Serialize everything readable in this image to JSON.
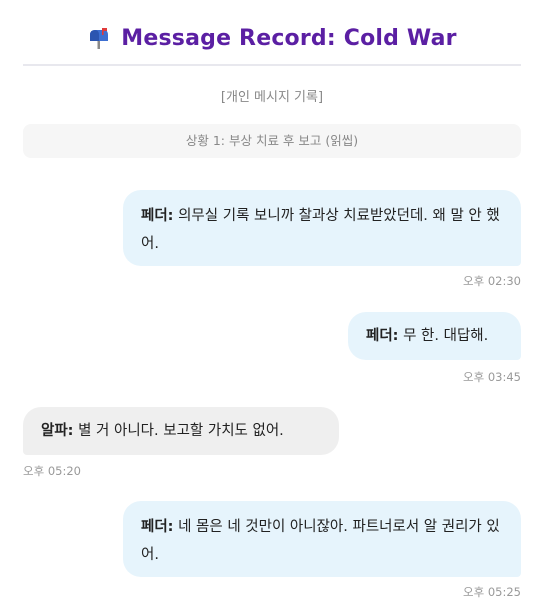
{
  "header": {
    "icon": "mailbox-icon",
    "title": "Message Record: Cold War"
  },
  "record_label": "[개인 메시지 기록]",
  "scene_label": "상황 1: 부상 치료 후 보고 (읽씹)",
  "messages": [
    {
      "speaker": "페더:",
      "text": "의무실 기록 보니까 찰과상 치료받았던데. 왜 말 안 했어.",
      "time": "오후 02:30",
      "side": "right"
    },
    {
      "speaker": "페더:",
      "text": "무 한. 대답해.",
      "time": "오후 03:45",
      "side": "right"
    },
    {
      "speaker": "알파:",
      "text": "별 거 아니다. 보고할 가치도 없어.",
      "time": "오후 05:20",
      "side": "left"
    },
    {
      "speaker": "페더:",
      "text": "네 몸은 네 것만이 아니잖아. 파트너로서 알 권리가 있어.",
      "time": "오후 05:25",
      "side": "right"
    }
  ],
  "colors": {
    "title": "#5b1fa3",
    "bubble_right": "#e6f4fc",
    "bubble_left": "#efefef"
  }
}
